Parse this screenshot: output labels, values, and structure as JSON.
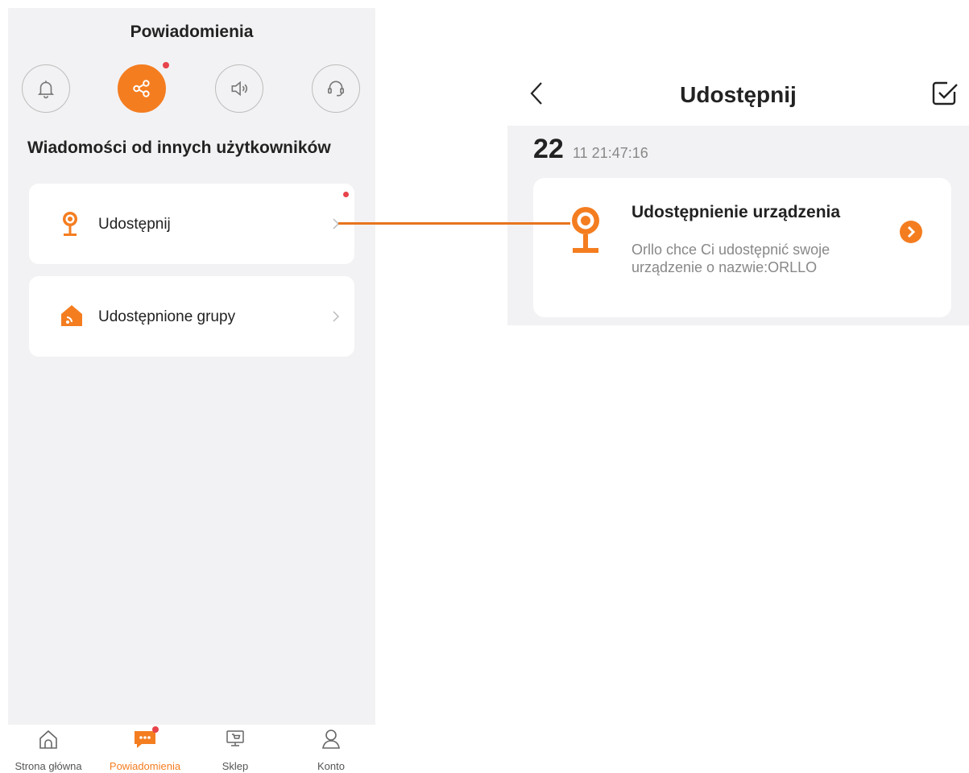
{
  "left": {
    "title": "Powiadomienia",
    "category_icons": [
      "bell-icon",
      "share-icon",
      "speaker-icon",
      "headset-icon"
    ],
    "active_category": "share-icon",
    "section_title": "Wiadomości od innych użytkowników",
    "items": [
      {
        "label": "Udostępnij",
        "icon": "camera-icon",
        "has_badge": true
      },
      {
        "label": "Udostępnione grupy",
        "icon": "shared-home-icon",
        "has_badge": false
      }
    ]
  },
  "tabbar": {
    "tabs": [
      {
        "label": "Strona główna",
        "icon": "home-icon",
        "active": false
      },
      {
        "label": "Powiadomienia",
        "icon": "chat-icon",
        "active": true,
        "has_badge": true
      },
      {
        "label": "Sklep",
        "icon": "store-icon",
        "active": false
      },
      {
        "label": "Konto",
        "icon": "user-icon",
        "active": false
      }
    ]
  },
  "right": {
    "title": "Udostępnij",
    "date_day": "22",
    "date_rest": "11 21:47:16",
    "notification": {
      "title": "Udostępnienie urządzenia",
      "body": "Orllo  chce Ci udostępnić swoje urządzenie o nazwie:ORLLO"
    }
  },
  "colors": {
    "accent": "#f47d20",
    "badge": "#e8434b",
    "panel_bg": "#f2f2f4",
    "connector": "#e8741d"
  }
}
